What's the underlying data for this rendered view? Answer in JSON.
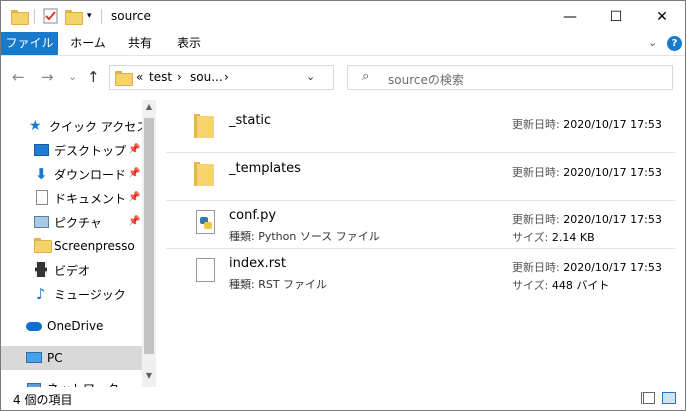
{
  "window": {
    "title": "source",
    "controls": {
      "minimize": "—",
      "maximize": "☐",
      "close": "✕"
    }
  },
  "ribbon": {
    "tabs": [
      "ファイル",
      "ホーム",
      "共有",
      "表示"
    ],
    "collapse_glyph": "⌄",
    "help_glyph": "?"
  },
  "addressbar": {
    "overflow": "«",
    "crumbs": [
      "test",
      "sou..."
    ],
    "separator": "›",
    "dropdown_glyph": "⌄",
    "refresh_glyph": "↻"
  },
  "search": {
    "placeholder": "sourceの検索"
  },
  "nav": {
    "back": "←",
    "forward": "→",
    "history": "⌄",
    "up": "↑",
    "items": [
      {
        "label": "クイック アクセス",
        "icon": "quick-access-star-icon",
        "pinned": false
      },
      {
        "label": "デスクトップ",
        "icon": "desktop-icon",
        "pinned": true
      },
      {
        "label": "ダウンロード",
        "icon": "download-icon",
        "pinned": true
      },
      {
        "label": "ドキュメント",
        "icon": "document-icon",
        "pinned": true
      },
      {
        "label": "ピクチャ",
        "icon": "picture-icon",
        "pinned": true
      },
      {
        "label": "Screenpresso",
        "icon": "folder-icon",
        "pinned": false
      },
      {
        "label": "ビデオ",
        "icon": "video-icon",
        "pinned": false
      },
      {
        "label": "ミュージック",
        "icon": "music-icon",
        "pinned": false
      },
      {
        "label": "OneDrive",
        "icon": "onedrive-cloud-icon",
        "pinned": false
      },
      {
        "label": "PC",
        "icon": "pc-icon",
        "pinned": false,
        "selected": true
      },
      {
        "label": "ネットワーク",
        "icon": "network-icon",
        "pinned": false
      }
    ],
    "pin_glyph": "📌"
  },
  "content": {
    "date_label": "更新日時:",
    "type_label": "種類:",
    "size_label": "サイズ:",
    "files": [
      {
        "name": "_static",
        "kind": "folder",
        "modified": "2020/10/17 17:53",
        "type": "",
        "size": ""
      },
      {
        "name": "_templates",
        "kind": "folder",
        "modified": "2020/10/17 17:53",
        "type": "",
        "size": ""
      },
      {
        "name": "conf.py",
        "kind": "python",
        "modified": "2020/10/17 17:53",
        "type": "Python ソース ファイル",
        "size": "2.14 KB"
      },
      {
        "name": "index.rst",
        "kind": "text",
        "modified": "2020/10/17 17:53",
        "type": "RST ファイル",
        "size": "448 バイト"
      }
    ]
  },
  "statusbar": {
    "item_count": "4 個の項目"
  }
}
